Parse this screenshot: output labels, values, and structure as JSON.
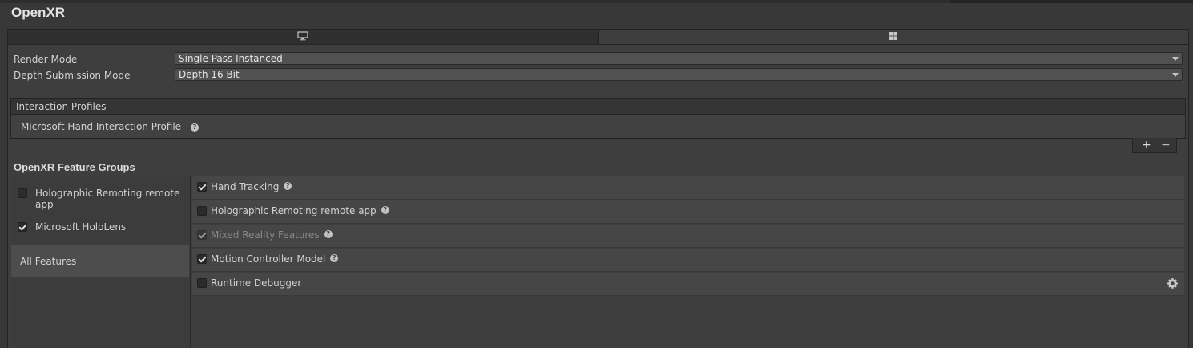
{
  "title": "OpenXR",
  "platform_tabs": [
    {
      "name": "standalone",
      "icon": "monitor-icon"
    },
    {
      "name": "windows",
      "icon": "windows-icon"
    }
  ],
  "settings": {
    "render_mode": {
      "label": "Render Mode",
      "value": "Single Pass Instanced"
    },
    "depth_submission_mode": {
      "label": "Depth Submission Mode",
      "value": "Depth 16 Bit"
    }
  },
  "interaction_profiles": {
    "header": "Interaction Profiles",
    "items": [
      "Microsoft Hand Interaction Profile"
    ],
    "add_label": "+",
    "remove_label": "−"
  },
  "feature_groups": {
    "title": "OpenXR Feature Groups",
    "groups": [
      {
        "label": "Holographic Remoting remote app",
        "checked": false
      },
      {
        "label": "Microsoft HoloLens",
        "checked": true
      },
      {
        "label": "All Features",
        "selected": true
      }
    ],
    "features": [
      {
        "label": "Hand Tracking",
        "checked": true,
        "disabled": false,
        "help": true
      },
      {
        "label": "Holographic Remoting remote app",
        "checked": false,
        "disabled": false,
        "help": true
      },
      {
        "label": "Mixed Reality Features",
        "checked": true,
        "disabled": true,
        "help": true
      },
      {
        "label": "Motion Controller Model",
        "checked": true,
        "disabled": false,
        "help": true
      },
      {
        "label": "Runtime Debugger",
        "checked": false,
        "disabled": false,
        "help": false,
        "settings_icon": "gear-icon"
      }
    ]
  },
  "colors": {
    "background": "#383838",
    "panel": "#3e3e3e",
    "dropdown": "#515151",
    "selected_group": "#4d4d4d",
    "feature_row": "#464646"
  }
}
